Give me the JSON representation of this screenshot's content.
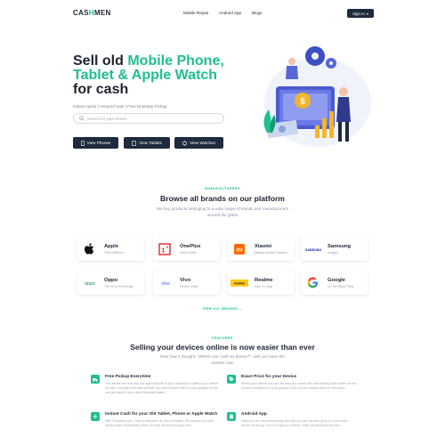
{
  "header": {
    "logo_part1": "CAS",
    "logo_part2": "H",
    "logo_part3": "MEN",
    "nav": [
      "Mobile Repair",
      "Android App",
      "Blogs"
    ],
    "signin_label": "Sign In"
  },
  "hero": {
    "title_line1_a": "Sell old ",
    "title_line1_b": "Mobile Phone,",
    "title_line2": "Tablet & Apple Watch",
    "title_line3": "for cash",
    "subtitle": "Instant quote | Assured Sale | Free Doorstep Pickup",
    "search_placeholder": "Search for your Device",
    "buttons": [
      "View Phones",
      "View Tablets",
      "View Watches"
    ]
  },
  "manufacturers": {
    "eyebrow": "MANUFACTURERS",
    "title": "Browse all brands on our platform",
    "description": "We buy products belonging to a wide range of brands and manufacturers around the globe",
    "brands": [
      {
        "name": "Apple",
        "tagline": "Think Different",
        "logo": "apple-icon"
      },
      {
        "name": "OnePlus",
        "tagline": "Never Settle",
        "logo": "oneplus-icon"
      },
      {
        "name": "Xiaomi",
        "tagline": "Making Quality Products",
        "logo": "xiaomi-icon"
      },
      {
        "name": "Samsung",
        "tagline": "Imagine",
        "logo": "samsung-icon"
      },
      {
        "name": "Oppo",
        "tagline": "The Art of Technology",
        "logo": "oppo-icon"
      },
      {
        "name": "Vivo",
        "tagline": "Perfect Selfie",
        "logo": "vivo-icon"
      },
      {
        "name": "Realme",
        "tagline": "Dare To Leap",
        "logo": "realme-icon"
      },
      {
        "name": "Google",
        "tagline": "Do The Right Thing",
        "logo": "google-icon"
      }
    ],
    "view_all": "VIEW ALL BRANDS →"
  },
  "features": {
    "eyebrow": "FEATURES",
    "title": "Selling your devices online is now easier than ever",
    "description": "Ever had a thought, \"Where can I sell my phone?\", well you have the answer now.",
    "items": [
      {
        "title": "Free Pickup Everytime",
        "desc": "You decide the time and our agent will be at your doorstep to collect your device on time. Our agent will also provide you with instant cash for your gadget so you can get back to your other important tasks.",
        "icon": "truck-icon"
      },
      {
        "title": "Exact Price for your Device",
        "desc": "Select your device and we will help you unlock the best selling price based on the present conditions of your gadget & the current market price for the same.",
        "icon": "tag-icon"
      },
      {
        "title": "Instant Cash for your Old Tablet, Phone or Apple Watch",
        "desc": "With Cashmen your Cash is delivered at Your Doorstep. We provide you with instant cash immediately when we pick device from your end.",
        "icon": "cash-icon"
      },
      {
        "title": "Android App",
        "desc": "Now you can use Android app will help you get the best price for your used device on the go. Our iOS app is currently under development as well.",
        "icon": "android-icon"
      }
    ]
  },
  "colors": {
    "accent": "#1fbf8f",
    "dark": "#1e2a3d"
  }
}
